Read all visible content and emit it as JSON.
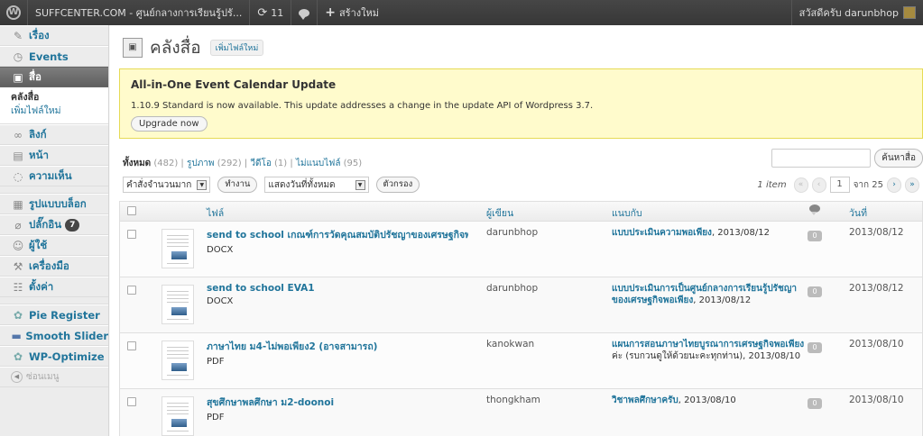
{
  "adminbar": {
    "site_title": "SUFFCENTER.COM - ศูนย์กลางการเรียนรู้ปรั...",
    "updates_count": "11",
    "new_label": "สร้างใหม่",
    "greeting": "สวัสดีครับ darunbhop"
  },
  "sidebar": {
    "items": [
      {
        "label": "เรื่อง",
        "icon": "pin-icon"
      },
      {
        "label": "Events",
        "icon": "calendar-icon"
      },
      {
        "label": "สื่อ",
        "icon": "media-icon"
      },
      {
        "label": "ลิงก์",
        "icon": "link-icon"
      },
      {
        "label": "หน้า",
        "icon": "page-icon"
      },
      {
        "label": "ความเห็น",
        "icon": "comment-icon"
      },
      {
        "label": "รูปแบบบล็อก",
        "icon": "appearance-icon"
      },
      {
        "label": "ปลั๊กอิน",
        "icon": "plugin-icon",
        "badge": "7"
      },
      {
        "label": "ผู้ใช้",
        "icon": "users-icon"
      },
      {
        "label": "เครื่องมือ",
        "icon": "tools-icon"
      },
      {
        "label": "ตั้งค่า",
        "icon": "settings-icon"
      },
      {
        "label": "Pie Register",
        "icon": "pie-icon"
      },
      {
        "label": "Smooth Slider",
        "icon": "slider-icon"
      },
      {
        "label": "WP-Optimize",
        "icon": "optimize-icon"
      }
    ],
    "submenu": [
      "คลังสื่อ",
      "เพิ่มไฟล์ใหม่"
    ],
    "collapse_label": "ซ่อนเมนู"
  },
  "page": {
    "title": "คลังสื่อ",
    "add_new": "เพิ่มไฟล์ใหม่"
  },
  "notice": {
    "title": "All-in-One Event Calendar Update",
    "text": "1.10.9 Standard is now available. This update addresses a change in the update API of Wordpress 3.7.",
    "button": "Upgrade now"
  },
  "filters": {
    "all_label": "ทั้งหมด",
    "all_count": "(482)",
    "image_label": "รูปภาพ",
    "image_count": "(292)",
    "video_label": "วีดีโอ",
    "video_count": "(1)",
    "unattached_label": "ไม่แนบไฟล์",
    "unattached_count": "(95)",
    "sep": "|"
  },
  "search": {
    "button": "ค้นหาสื่อ"
  },
  "actions": {
    "bulk_select": "คำสั่งจำนวนมาก",
    "apply": "ทำงาน",
    "date_select": "แสดงวันที่ทั้งหมด",
    "filter": "ตัวกรอง"
  },
  "pagination": {
    "items": "1 item",
    "first": "«",
    "prev": "‹",
    "current": "1",
    "of": "จาก 25",
    "next": "›",
    "last": "»"
  },
  "table": {
    "headers": {
      "file": "ไฟล์",
      "author": "ผู้เขียน",
      "attached": "แนบกับ",
      "date": "วันที่"
    },
    "rows": [
      {
        "title": "send to school เกณฑ์การวัดคุณสมบัติปรัชญาของเศรษฐกิจพอเพียง",
        "ext": "DOCX",
        "author": "darunbhop",
        "attached_link": "แบบประเมินความพอเพียง",
        "attached_rest": ", 2013/08/12",
        "comments": "0",
        "date": "2013/08/12"
      },
      {
        "title": "send to school EVA1",
        "ext": "DOCX",
        "author": "darunbhop",
        "attached_link": "แบบประเมินการเป็นศูนย์กลางการเรียนรู้ปรัชญาของเศรษฐกิจพอเพียง",
        "attached_rest": ", 2013/08/12",
        "comments": "0",
        "date": "2013/08/12"
      },
      {
        "title": "ภาษาไทย ม4-ไม่พอเพียง2 (อาจสามารถ)",
        "ext": "PDF",
        "author": "kanokwan",
        "attached_link": "แผนการสอนภาษาไทยบูรณาการเศรษฐกิจพอเพียง",
        "attached_rest": " ค่ะ (รบกวนดูให้ด้วยนะคะทุกท่าน), 2013/08/10",
        "comments": "0",
        "date": "2013/08/10"
      },
      {
        "title": "สุขศึกษาพลศึกษา ม2-doonoi",
        "ext": "PDF",
        "author": "thongkham",
        "attached_link": "วิชาพลศึกษาครับ",
        "attached_rest": ", 2013/08/10",
        "comments": "0",
        "date": "2013/08/10"
      }
    ]
  },
  "colors": {
    "link": "#21759b",
    "adminbar": "#464646",
    "notice_bg": "#fffbcc",
    "notice_border": "#e6db55"
  }
}
